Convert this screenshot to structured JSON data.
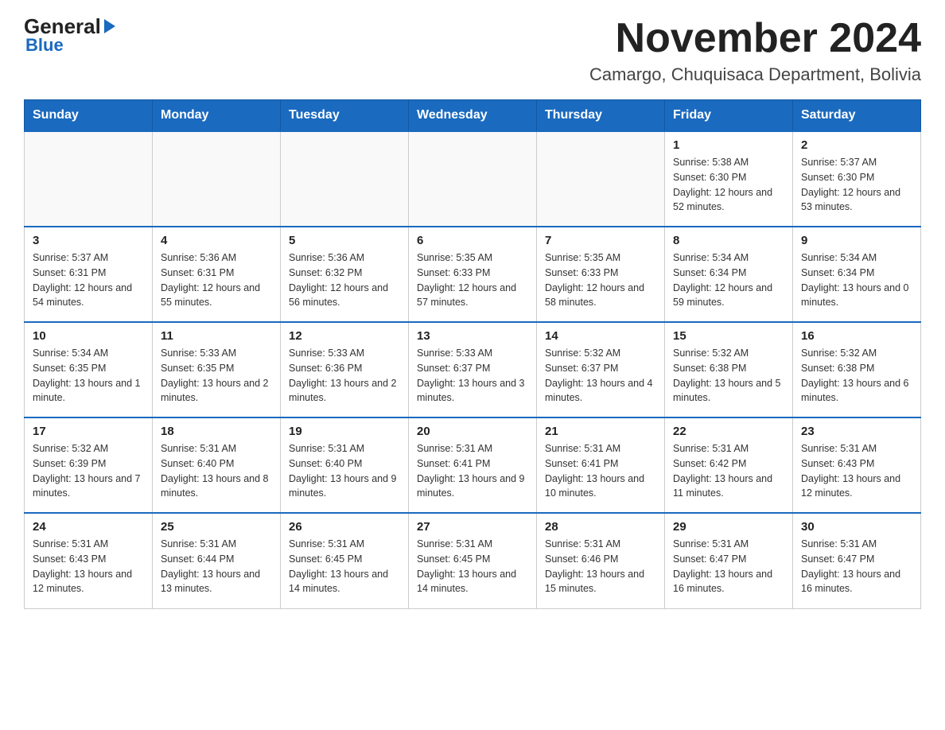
{
  "logo": {
    "general": "General",
    "blue": "Blue",
    "arrow": "▶"
  },
  "header": {
    "month_title": "November 2024",
    "location": "Camargo, Chuquisaca Department, Bolivia"
  },
  "days_of_week": [
    "Sunday",
    "Monday",
    "Tuesday",
    "Wednesday",
    "Thursday",
    "Friday",
    "Saturday"
  ],
  "weeks": [
    [
      {
        "day": "",
        "info": ""
      },
      {
        "day": "",
        "info": ""
      },
      {
        "day": "",
        "info": ""
      },
      {
        "day": "",
        "info": ""
      },
      {
        "day": "",
        "info": ""
      },
      {
        "day": "1",
        "info": "Sunrise: 5:38 AM\nSunset: 6:30 PM\nDaylight: 12 hours and 52 minutes."
      },
      {
        "day": "2",
        "info": "Sunrise: 5:37 AM\nSunset: 6:30 PM\nDaylight: 12 hours and 53 minutes."
      }
    ],
    [
      {
        "day": "3",
        "info": "Sunrise: 5:37 AM\nSunset: 6:31 PM\nDaylight: 12 hours and 54 minutes."
      },
      {
        "day": "4",
        "info": "Sunrise: 5:36 AM\nSunset: 6:31 PM\nDaylight: 12 hours and 55 minutes."
      },
      {
        "day": "5",
        "info": "Sunrise: 5:36 AM\nSunset: 6:32 PM\nDaylight: 12 hours and 56 minutes."
      },
      {
        "day": "6",
        "info": "Sunrise: 5:35 AM\nSunset: 6:33 PM\nDaylight: 12 hours and 57 minutes."
      },
      {
        "day": "7",
        "info": "Sunrise: 5:35 AM\nSunset: 6:33 PM\nDaylight: 12 hours and 58 minutes."
      },
      {
        "day": "8",
        "info": "Sunrise: 5:34 AM\nSunset: 6:34 PM\nDaylight: 12 hours and 59 minutes."
      },
      {
        "day": "9",
        "info": "Sunrise: 5:34 AM\nSunset: 6:34 PM\nDaylight: 13 hours and 0 minutes."
      }
    ],
    [
      {
        "day": "10",
        "info": "Sunrise: 5:34 AM\nSunset: 6:35 PM\nDaylight: 13 hours and 1 minute."
      },
      {
        "day": "11",
        "info": "Sunrise: 5:33 AM\nSunset: 6:35 PM\nDaylight: 13 hours and 2 minutes."
      },
      {
        "day": "12",
        "info": "Sunrise: 5:33 AM\nSunset: 6:36 PM\nDaylight: 13 hours and 2 minutes."
      },
      {
        "day": "13",
        "info": "Sunrise: 5:33 AM\nSunset: 6:37 PM\nDaylight: 13 hours and 3 minutes."
      },
      {
        "day": "14",
        "info": "Sunrise: 5:32 AM\nSunset: 6:37 PM\nDaylight: 13 hours and 4 minutes."
      },
      {
        "day": "15",
        "info": "Sunrise: 5:32 AM\nSunset: 6:38 PM\nDaylight: 13 hours and 5 minutes."
      },
      {
        "day": "16",
        "info": "Sunrise: 5:32 AM\nSunset: 6:38 PM\nDaylight: 13 hours and 6 minutes."
      }
    ],
    [
      {
        "day": "17",
        "info": "Sunrise: 5:32 AM\nSunset: 6:39 PM\nDaylight: 13 hours and 7 minutes."
      },
      {
        "day": "18",
        "info": "Sunrise: 5:31 AM\nSunset: 6:40 PM\nDaylight: 13 hours and 8 minutes."
      },
      {
        "day": "19",
        "info": "Sunrise: 5:31 AM\nSunset: 6:40 PM\nDaylight: 13 hours and 9 minutes."
      },
      {
        "day": "20",
        "info": "Sunrise: 5:31 AM\nSunset: 6:41 PM\nDaylight: 13 hours and 9 minutes."
      },
      {
        "day": "21",
        "info": "Sunrise: 5:31 AM\nSunset: 6:41 PM\nDaylight: 13 hours and 10 minutes."
      },
      {
        "day": "22",
        "info": "Sunrise: 5:31 AM\nSunset: 6:42 PM\nDaylight: 13 hours and 11 minutes."
      },
      {
        "day": "23",
        "info": "Sunrise: 5:31 AM\nSunset: 6:43 PM\nDaylight: 13 hours and 12 minutes."
      }
    ],
    [
      {
        "day": "24",
        "info": "Sunrise: 5:31 AM\nSunset: 6:43 PM\nDaylight: 13 hours and 12 minutes."
      },
      {
        "day": "25",
        "info": "Sunrise: 5:31 AM\nSunset: 6:44 PM\nDaylight: 13 hours and 13 minutes."
      },
      {
        "day": "26",
        "info": "Sunrise: 5:31 AM\nSunset: 6:45 PM\nDaylight: 13 hours and 14 minutes."
      },
      {
        "day": "27",
        "info": "Sunrise: 5:31 AM\nSunset: 6:45 PM\nDaylight: 13 hours and 14 minutes."
      },
      {
        "day": "28",
        "info": "Sunrise: 5:31 AM\nSunset: 6:46 PM\nDaylight: 13 hours and 15 minutes."
      },
      {
        "day": "29",
        "info": "Sunrise: 5:31 AM\nSunset: 6:47 PM\nDaylight: 13 hours and 16 minutes."
      },
      {
        "day": "30",
        "info": "Sunrise: 5:31 AM\nSunset: 6:47 PM\nDaylight: 13 hours and 16 minutes."
      }
    ]
  ]
}
